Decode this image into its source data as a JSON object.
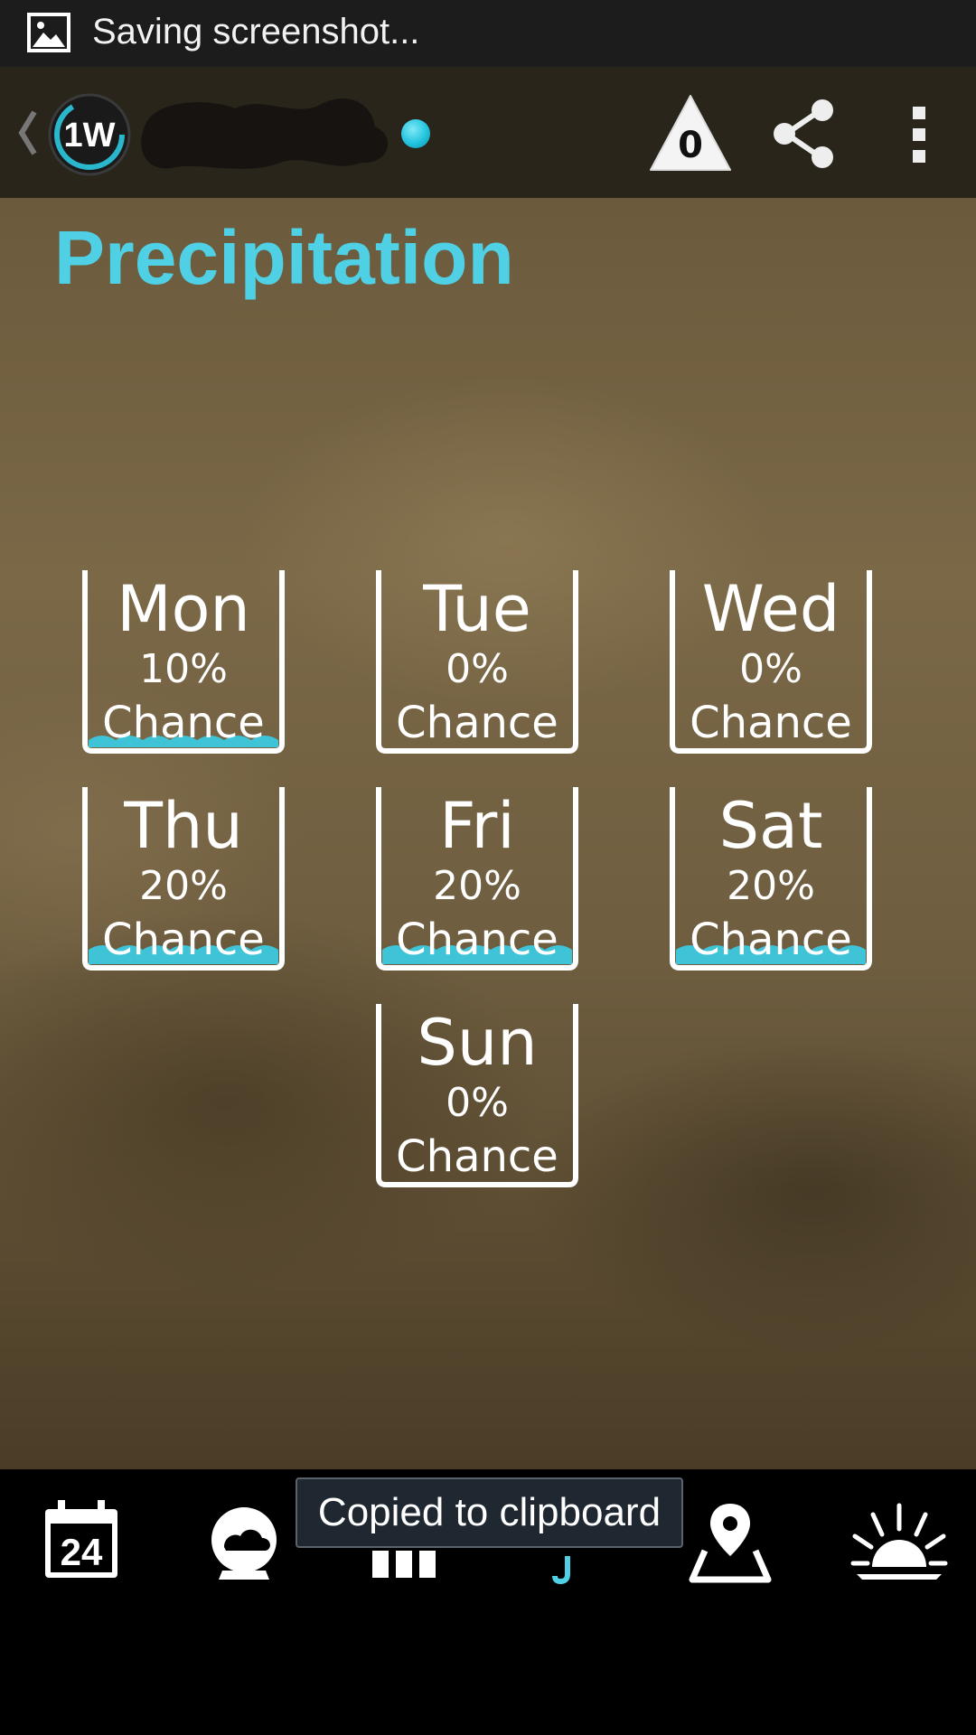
{
  "status_bar": {
    "notification_icon": "image-icon",
    "text": "Saving screenshot..."
  },
  "action_bar": {
    "back_icon": "chevron-left-icon",
    "logo_text": "1W",
    "location_name": "",
    "alert_count": "0",
    "share_icon": "share-icon",
    "overflow_icon": "overflow-menu-icon"
  },
  "page": {
    "title": "Precipitation"
  },
  "days": [
    {
      "name": "Mon",
      "percent": "10%",
      "chance": "Chance",
      "probability": 0.1
    },
    {
      "name": "Tue",
      "percent": "0%",
      "chance": "Chance",
      "probability": 0.0
    },
    {
      "name": "Wed",
      "percent": "0%",
      "chance": "Chance",
      "probability": 0.0
    },
    {
      "name": "Thu",
      "percent": "20%",
      "chance": "Chance",
      "probability": 0.2
    },
    {
      "name": "Fri",
      "percent": "20%",
      "chance": "Chance",
      "probability": 0.2
    },
    {
      "name": "Sat",
      "percent": "20%",
      "chance": "Chance",
      "probability": 0.2
    },
    {
      "name": "Sun",
      "percent": "0%",
      "chance": "Chance",
      "probability": 0.0
    }
  ],
  "bottom_nav": [
    {
      "icon": "calendar-24-icon",
      "label": "24"
    },
    {
      "icon": "current-conditions-icon"
    },
    {
      "icon": "bar-chart-icon"
    },
    {
      "icon": "umbrella-icon",
      "active": true
    },
    {
      "icon": "map-pin-icon"
    },
    {
      "icon": "sun-icon"
    }
  ],
  "toast": {
    "text": "Copied to clipboard"
  },
  "colors": {
    "accent": "#4fd0e4",
    "water": "#3fc3d6",
    "action_bar_bg": "#2a251b"
  }
}
